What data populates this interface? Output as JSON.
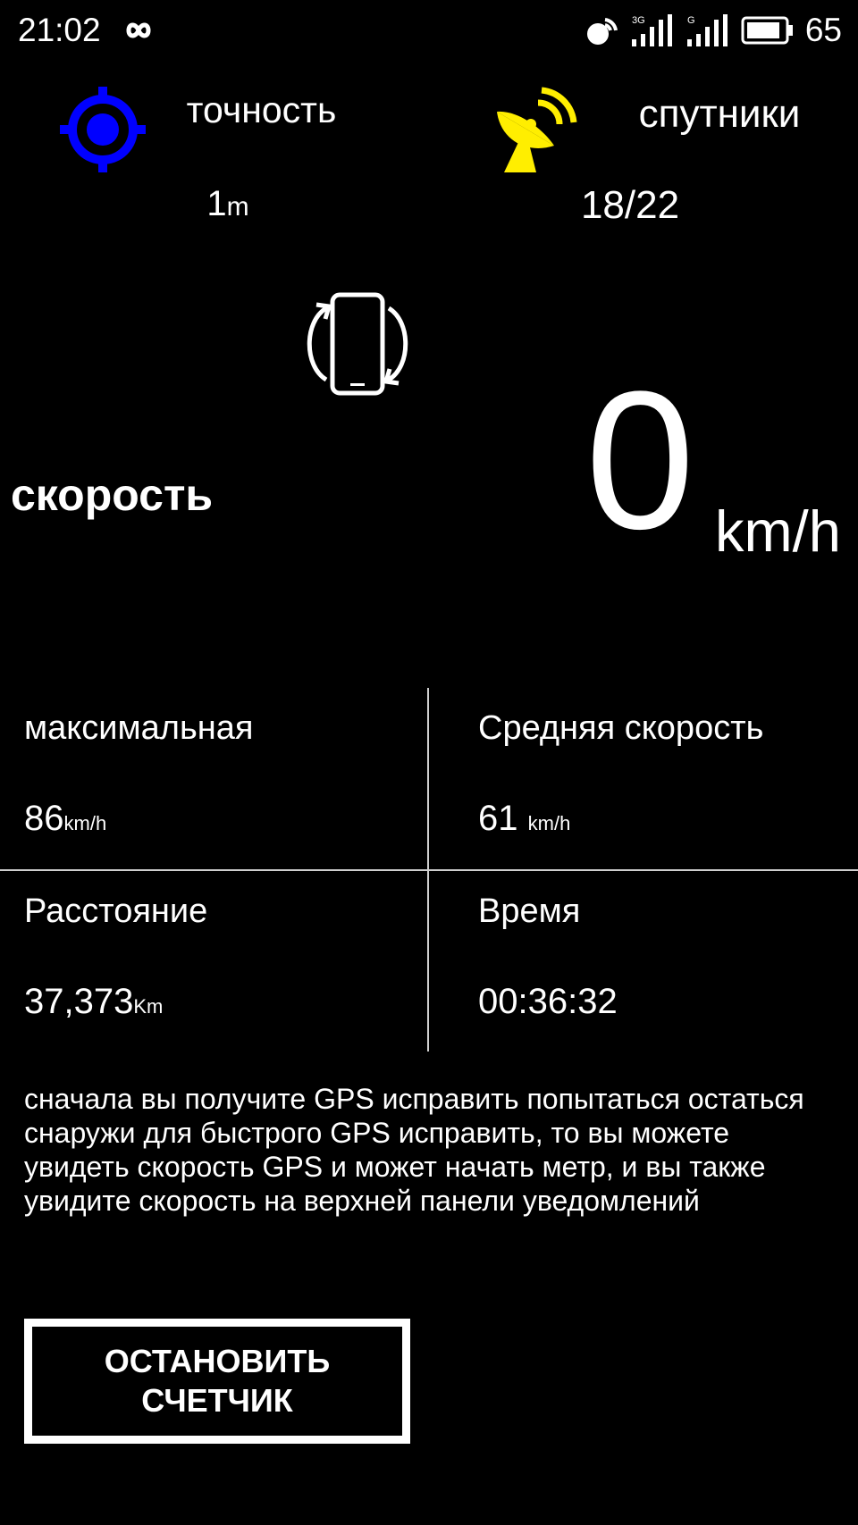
{
  "status_bar": {
    "time": "21:02",
    "battery_level": "65",
    "network_1": "3G",
    "network_2": "G",
    "icons": [
      "infinity-icon",
      "location-signal-icon",
      "signal-3g-icon",
      "signal-g-icon",
      "battery-icon"
    ]
  },
  "accuracy": {
    "label": "точность",
    "value": "1",
    "unit": "m",
    "icon": "crosshair-icon",
    "icon_color": "#0000ff"
  },
  "satellites": {
    "label": "спутники",
    "value": "18/22",
    "icon": "satellite-dish-icon",
    "icon_color": "#ffee00"
  },
  "rotate": {
    "icon": "rotate-screen-icon"
  },
  "speed": {
    "label": "скорость",
    "value": "0",
    "unit": "km/h"
  },
  "stats": {
    "max": {
      "label": "максимальная",
      "value": "86",
      "unit": "km/h"
    },
    "average": {
      "label": "Средняя скорость",
      "value": "61",
      "unit": "km/h"
    },
    "distance": {
      "label": "Расстояние",
      "value": "37,373",
      "unit": "Km"
    },
    "time": {
      "label": "Время",
      "value": "00:36:32"
    }
  },
  "info_text": "сначала вы получите GPS исправить попытаться остаться снаружи для быстрого GPS исправить, то вы можете увидеть скорость GPS и может начать метр, и вы также увидите скорость на верхней панели уведомлений",
  "stop_button": {
    "line1": "ОСТАНОВИТЬ",
    "line2": "СЧЕТЧИК"
  },
  "colors": {
    "background": "#000000",
    "text": "#ffffff",
    "divider": "#cfcfcf"
  }
}
